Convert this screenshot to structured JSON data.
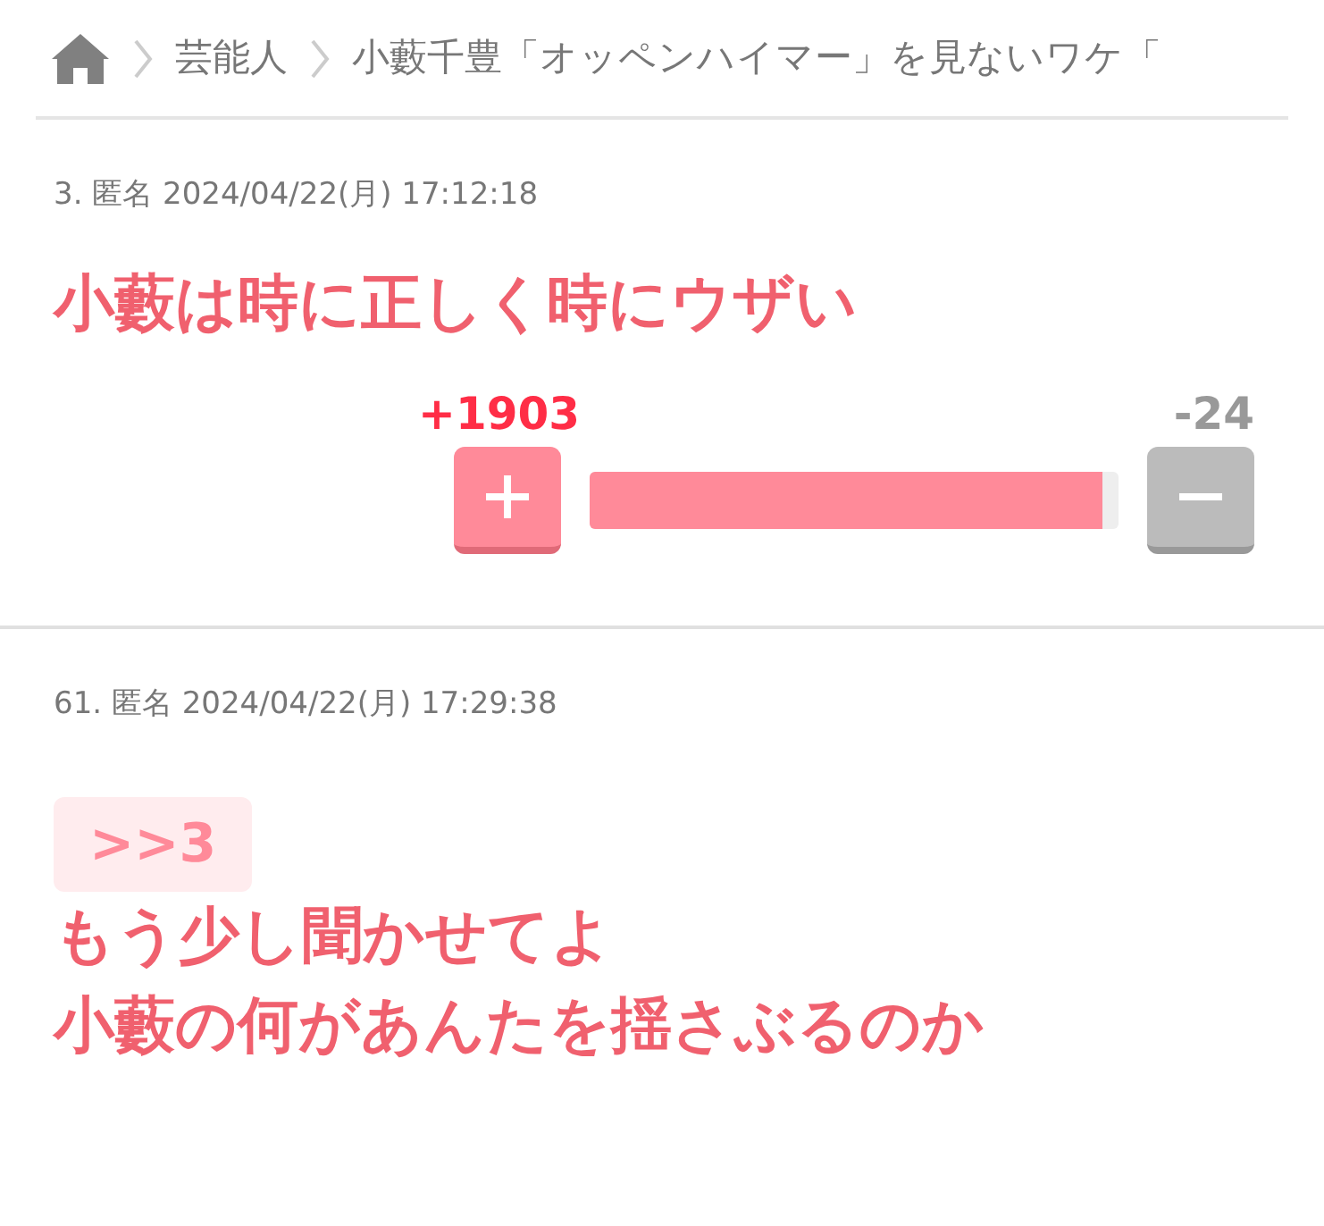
{
  "breadcrumb": {
    "items": [
      "芸能人",
      "小藪千豊「オッペンハイマー」を見ないワケ「"
    ]
  },
  "comments": [
    {
      "meta": "3. 匿名 2024/04/22(月) 17:12:18",
      "lines": [
        "小藪は時に正しく時にウザい"
      ],
      "vote": {
        "plus": "+1903",
        "minus": "-24",
        "level": 0.97
      }
    },
    {
      "meta": "61. 匿名 2024/04/22(月) 17:29:38",
      "anchor": ">>3",
      "lines": [
        "もう少し聞かせてよ",
        "小藪の何があんたを揺さぶるのか"
      ]
    }
  ]
}
